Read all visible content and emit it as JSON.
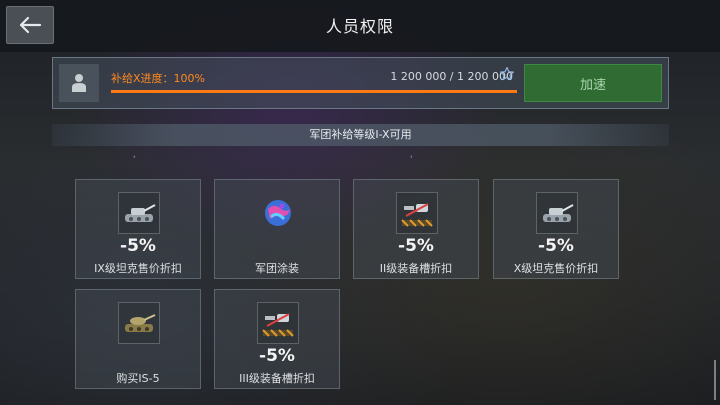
{
  "header": {
    "title": "人员权限",
    "back_icon": "arrow-left-icon"
  },
  "supply": {
    "progress_label": "补给X进度：100%",
    "progress_value": 1.0,
    "count_text": "1 200 000 / 1 200 000",
    "speed_button_label": "加速",
    "accent_color": "#ff7a12"
  },
  "section": {
    "title": "军团补给等级I-X可用"
  },
  "perks": [
    {
      "discount": "-5%",
      "name": "IX级坦克售价折扣",
      "icon": "tank-icon"
    },
    {
      "discount": "",
      "name": "军团涂装",
      "icon": "camo-icon"
    },
    {
      "discount": "-5%",
      "name": "II级装备槽折扣",
      "icon": "equipment-slot-icon"
    },
    {
      "discount": "-5%",
      "name": "X级坦克售价折扣",
      "icon": "tank-icon"
    },
    {
      "discount": "",
      "name": "购买IS-5",
      "icon": "tank-is5-icon"
    },
    {
      "discount": "-5%",
      "name": "III级装备槽折扣",
      "icon": "equipment-slot-icon"
    }
  ]
}
